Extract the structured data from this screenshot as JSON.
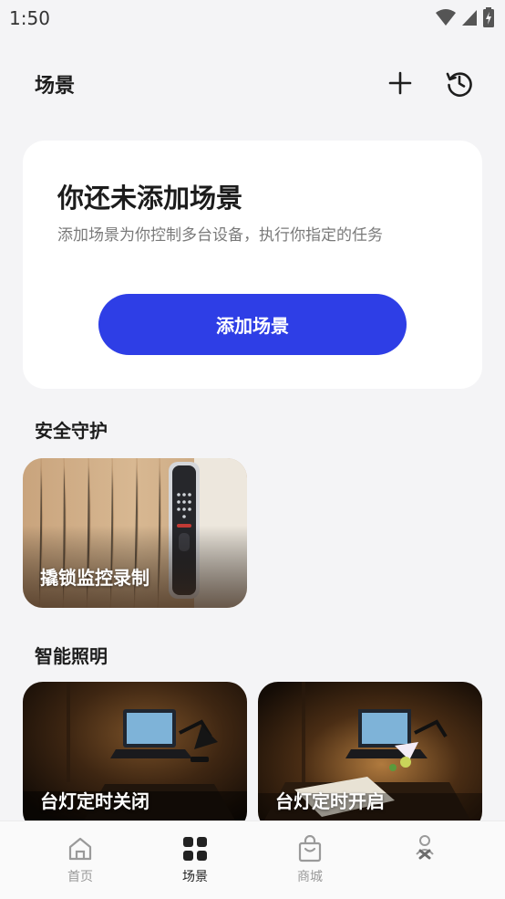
{
  "status_bar": {
    "time": "1:50"
  },
  "header": {
    "title": "场景"
  },
  "empty_state": {
    "title": "你还未添加场景",
    "description": "添加场景为你控制多台设备，执行你指定的任务",
    "button_label": "添加场景"
  },
  "sections": [
    {
      "title": "安全守护",
      "cards": [
        {
          "label": "撬锁监控录制"
        }
      ]
    },
    {
      "title": "智能照明",
      "cards": [
        {
          "label": "台灯定时关闭"
        },
        {
          "label": "台灯定时开启"
        }
      ]
    }
  ],
  "bottom_nav": {
    "active_color": "#222222",
    "inactive_color": "#9a9a9a",
    "items": [
      {
        "label": "首页",
        "icon": "home-icon"
      },
      {
        "label": "场景",
        "icon": "scene-grid-icon",
        "active": true
      },
      {
        "label": "商城",
        "icon": "shopping-bag-icon"
      },
      {
        "label": "",
        "icon": "profile-icon"
      }
    ]
  },
  "colors": {
    "accent": "#2e3ee6",
    "background": "#f4f4f6",
    "card": "#ffffff"
  }
}
